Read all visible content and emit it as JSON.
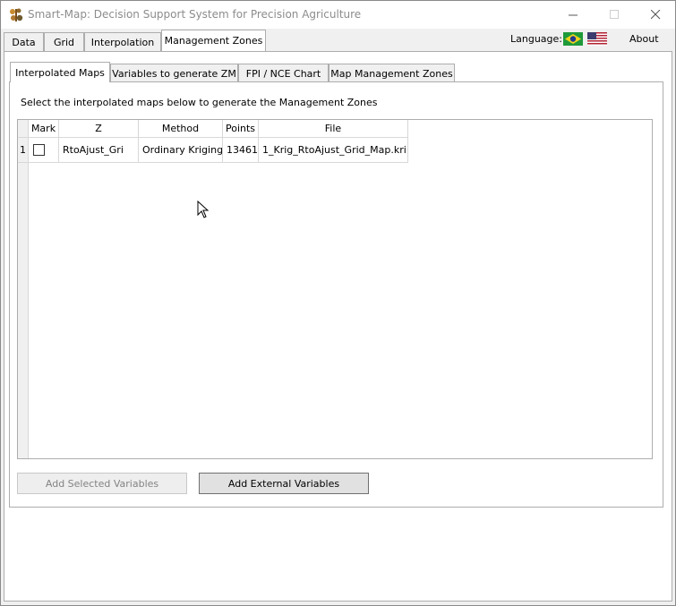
{
  "window": {
    "title": "Smart-Map: Decision Support System for Precision Agriculture",
    "controls": {
      "minimize": "—",
      "maximize": "☐",
      "close": "✕"
    }
  },
  "main_tabs": [
    {
      "label": "Data",
      "active": false
    },
    {
      "label": "Grid",
      "active": false
    },
    {
      "label": "Interpolation",
      "active": false
    },
    {
      "label": "Management Zones",
      "active": true
    }
  ],
  "header_right": {
    "language_label": "Language:",
    "flags": [
      "brazil-flag-icon",
      "usa-flag-icon"
    ],
    "about_label": "About"
  },
  "sub_tabs": [
    {
      "label": "Interpolated Maps",
      "active": true
    },
    {
      "label": "Variables to generate ZM",
      "active": false
    },
    {
      "label": "FPI / NCE Chart",
      "active": false
    },
    {
      "label": "Map Management Zones",
      "active": false
    }
  ],
  "instruction": "Select the interpolated maps below to generate the Management Zones",
  "table": {
    "columns": [
      "Mark",
      "Z",
      "Method",
      "Points",
      "File"
    ],
    "rows": [
      {
        "index": "1",
        "mark": false,
        "z": "RtoAjust_Gri",
        "method": "Ordinary Kriging",
        "points": "13461",
        "file": "1_Krig_RtoAjust_Grid_Map.kri"
      }
    ]
  },
  "buttons": {
    "add_selected": "Add Selected Variables",
    "add_external": "Add External Variables"
  },
  "colors": {
    "window_bg": "#f0f0f0",
    "pane_bg": "#ffffff",
    "border": "#adadad",
    "title_text": "#8c8c8c"
  }
}
